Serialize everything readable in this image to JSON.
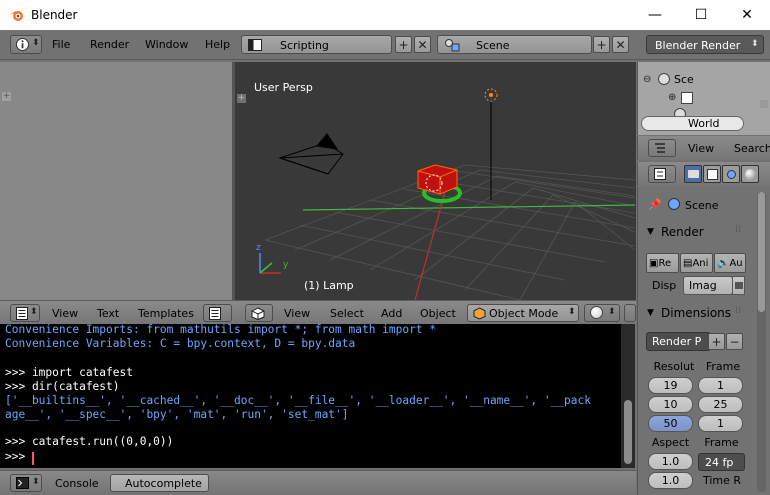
{
  "window": {
    "title": "Blender",
    "min_glyph": "—",
    "max_glyph": "☐",
    "close_glyph": "✕"
  },
  "menu": {
    "file": "File",
    "render": "Render",
    "window": "Window",
    "help": "Help"
  },
  "screen_layout": {
    "value": "Scripting"
  },
  "scene": {
    "value": "Scene"
  },
  "render_engine": {
    "value": "Blender Render"
  },
  "viewport": {
    "view_label": "User Persp",
    "object_label": "(1) Lamp"
  },
  "text_header": {
    "view": "View",
    "text": "Text",
    "templates": "Templates"
  },
  "view3d_header": {
    "view": "View",
    "select": "Select",
    "add": "Add",
    "object": "Object",
    "mode": "Object Mode"
  },
  "console": {
    "lines": [
      {
        "text": "Convenience Imports: from mathutils import *; from math import *",
        "kind": "info"
      },
      {
        "text": "Convenience Variables: C = bpy.context, D = bpy.data",
        "kind": "info"
      },
      {
        "text": "",
        "kind": "in"
      },
      {
        "text": ">>> import catafest",
        "kind": "in"
      },
      {
        "text": ">>> dir(catafest)",
        "kind": "in"
      },
      {
        "text": "['__builtins__', '__cached__', '__doc__', '__file__', '__loader__', '__name__', '__pack",
        "kind": "out"
      },
      {
        "text": "age__', '__spec__', 'bpy', 'mat', 'run', 'set_mat']",
        "kind": "out"
      },
      {
        "text": "",
        "kind": "in"
      },
      {
        "text": ">>> catafest.run((0,0,0))",
        "kind": "in"
      },
      {
        "text": ">>> ",
        "kind": "in"
      }
    ]
  },
  "console_footer": {
    "console": "Console",
    "autocomplete": "Autocomplete"
  },
  "outliner": {
    "item1": "Sce",
    "item3": "World"
  },
  "outliner_header": {
    "view": "View",
    "search": "Search"
  },
  "properties": {
    "scene_label": "Scene",
    "render_panel": "Render",
    "render_btn": "Re",
    "anim_btn": "Ani",
    "audio_btn": "Au",
    "display_label": "Disp",
    "display_value": "Imag",
    "dimensions_panel": "Dimensions",
    "preset": "Render P",
    "resolution_label": "Resolut",
    "frame_label": "Frame",
    "res_x": "19",
    "res_y": "10",
    "res_pct": "50",
    "frame_start": "1",
    "frame_end": "25",
    "frame_step": "1",
    "aspect_label": "Aspect",
    "frame_rate_label": "Frame",
    "aspect_x": "1.0",
    "aspect_y": "1.0",
    "fps": "24 fp",
    "time_label": "Time R"
  },
  "colors": {
    "bg": "#727272",
    "console_bg": "#000000",
    "console_info": "#6ea6ff",
    "viewport_bg": "#393939"
  }
}
